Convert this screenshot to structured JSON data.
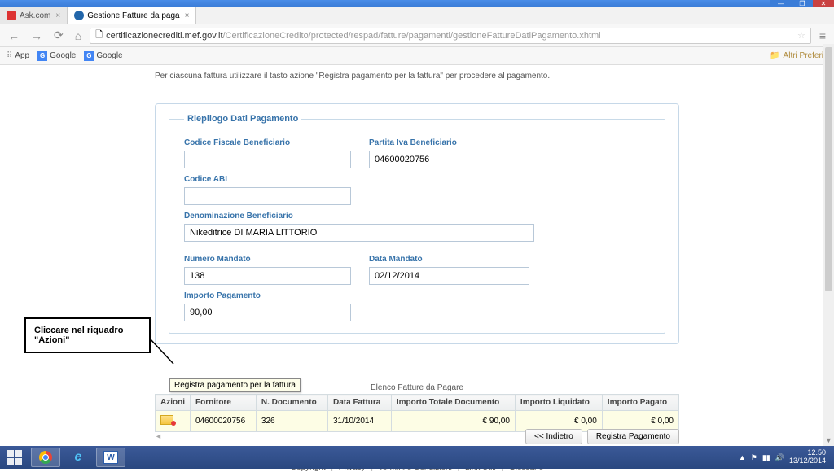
{
  "window": {
    "min": "—",
    "max": "❐",
    "close": "✕"
  },
  "tabs": [
    {
      "icon_name": "ask-icon",
      "label": "Ask.com",
      "close": "×"
    },
    {
      "icon_name": "mef-icon",
      "label": "Gestione Fatture da paga",
      "close": "×"
    }
  ],
  "nav": {
    "back": "←",
    "fwd": "→",
    "reload": "⟳",
    "home": "⌂",
    "url_host": "certificazionecrediti.mef.gov.it",
    "url_path": "/CertificazioneCredito/protected/respad/fatture/pagamenti/gestioneFattureDatiPagamento.xhtml",
    "menu": "≡"
  },
  "bookmarks": {
    "apps": "App",
    "items": [
      "Google",
      "Google"
    ],
    "right": "Altri Preferiti"
  },
  "instruction": "Per ciascuna fattura utilizzare il tasto azione \"Registra pagamento per la fattura\" per procedere al pagamento.",
  "fieldset": {
    "legend": "Riepilogo Dati Pagamento",
    "labels": {
      "cf": "Codice Fiscale Beneficiario",
      "piva": "Partita Iva Beneficiario",
      "abi": "Codice ABI",
      "denom": "Denominazione Beneficiario",
      "num": "Numero Mandato",
      "data": "Data Mandato",
      "importo": "Importo Pagamento"
    },
    "values": {
      "cf": "",
      "piva": "04600020756",
      "abi": "",
      "denom": "Nikeditrice DI MARIA LITTORIO",
      "num": "138",
      "data": "02/12/2014",
      "importo": "90,00"
    }
  },
  "table": {
    "title": "Elenco Fatture da Pagare",
    "headers": [
      "Azioni",
      "Fornitore",
      "N. Documento",
      "Data Fattura",
      "Importo Totale Documento",
      "Importo Liquidato",
      "Importo Pagato"
    ],
    "row": {
      "fornitore": "04600020756",
      "ndoc": "326",
      "data": "31/10/2014",
      "tot": "€ 90,00",
      "liq": "€ 0,00",
      "pag": "€ 0,00"
    }
  },
  "callout": "Cliccare nel riquadro \"Azioni\"",
  "tooltip": "Registra pagamento per la fattura",
  "buttons": {
    "back": "<< Indietro",
    "register": "Registra Pagamento"
  },
  "footer": [
    "Copyright",
    "Privacy",
    "Termini e Condizioni",
    "Link Utili",
    "Glossario"
  ],
  "tray": {
    "time": "12.50",
    "date": "13/12/2014"
  }
}
